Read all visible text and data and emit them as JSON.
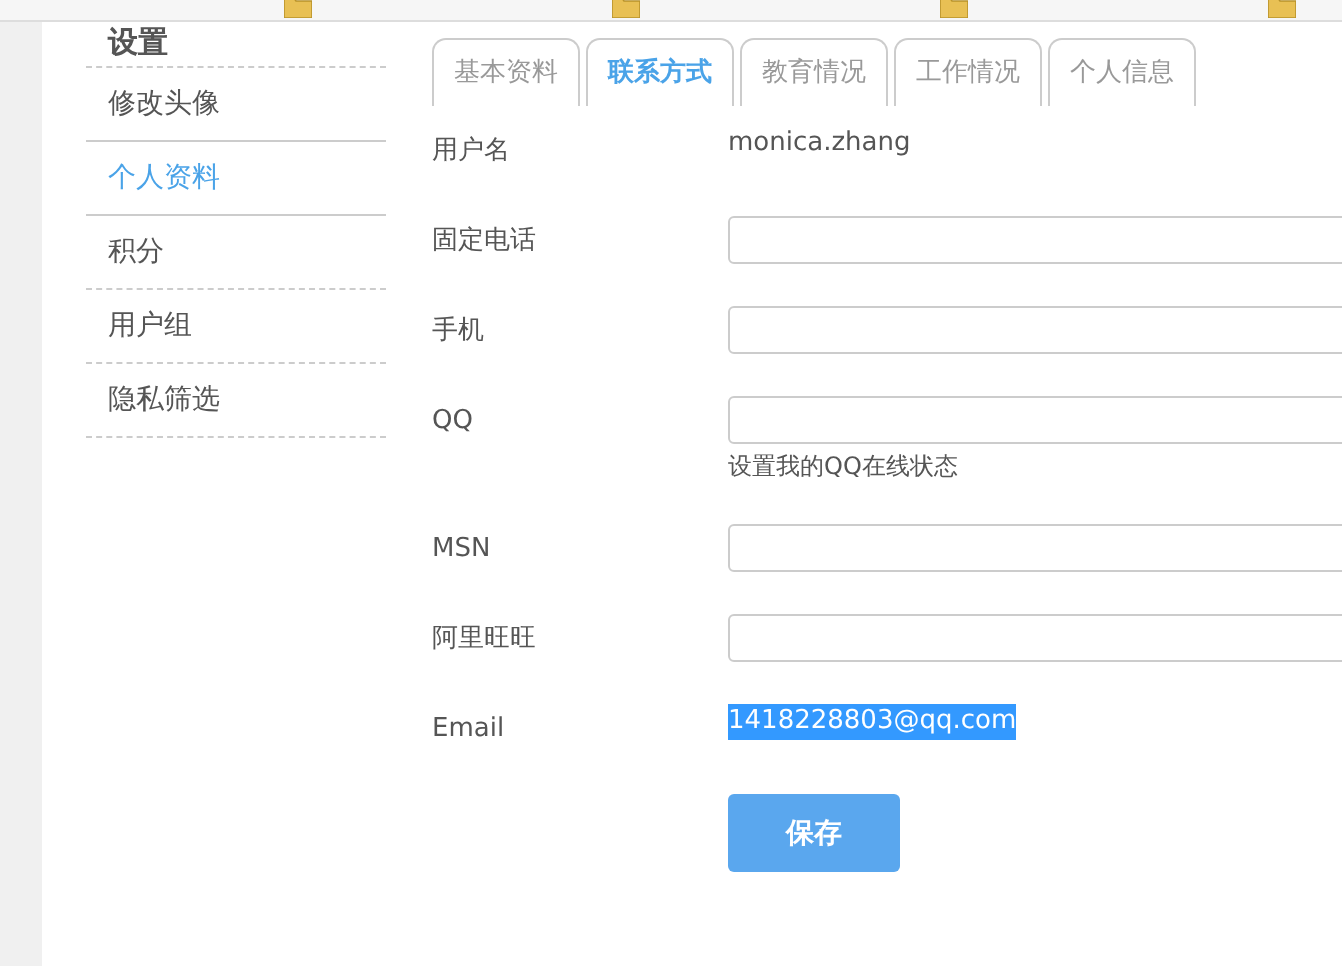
{
  "sidebar": {
    "title": "设置",
    "items": [
      {
        "label": "修改头像",
        "selected": false
      },
      {
        "label": "个人资料",
        "selected": true
      },
      {
        "label": "积分",
        "selected": false
      },
      {
        "label": "用户组",
        "selected": false
      },
      {
        "label": "隐私筛选",
        "selected": false
      }
    ]
  },
  "tabs": [
    {
      "label": "基本资料",
      "selected": false
    },
    {
      "label": "联系方式",
      "selected": true
    },
    {
      "label": "教育情况",
      "selected": false
    },
    {
      "label": "工作情况",
      "selected": false
    },
    {
      "label": "个人信息",
      "selected": false
    }
  ],
  "form": {
    "fields": [
      {
        "kind": "text",
        "label": "用户名",
        "value": "monica.zhang"
      },
      {
        "kind": "input",
        "label": "固定电话"
      },
      {
        "kind": "input",
        "label": "手机"
      },
      {
        "kind": "input",
        "label": "QQ",
        "hint": "设置我的QQ在线状态"
      },
      {
        "kind": "input",
        "label": "MSN"
      },
      {
        "kind": "input",
        "label": "阿里旺旺"
      },
      {
        "kind": "text",
        "label": "Email",
        "value": "1418228803@qq.com",
        "highlighted": true
      }
    ],
    "save_button": "保存"
  }
}
